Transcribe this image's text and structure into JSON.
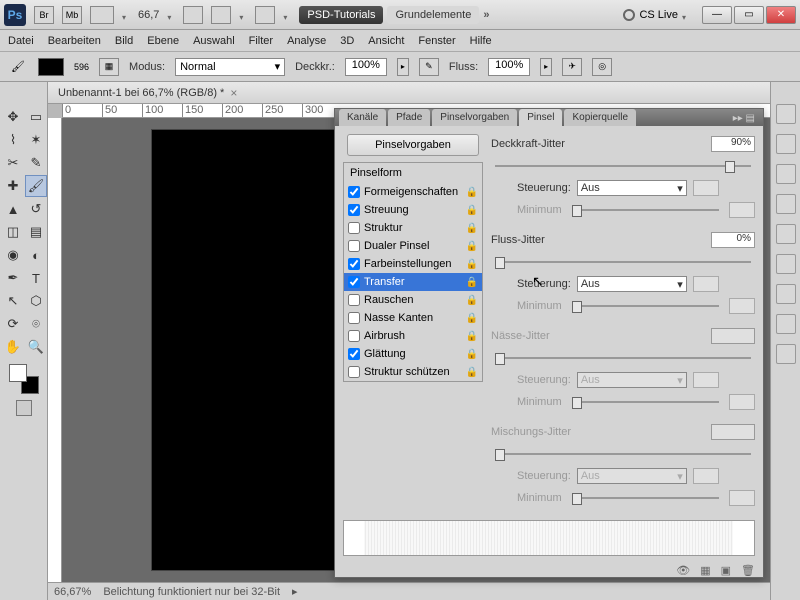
{
  "titlebar": {
    "zoom": "66,7",
    "crumbs": [
      "PSD-Tutorials",
      "Grundelemente"
    ],
    "cslive": "CS Live"
  },
  "menu": [
    "Datei",
    "Bearbeiten",
    "Bild",
    "Ebene",
    "Auswahl",
    "Filter",
    "Analyse",
    "3D",
    "Ansicht",
    "Fenster",
    "Hilfe"
  ],
  "options": {
    "size": "596",
    "mode_label": "Modus:",
    "mode_value": "Normal",
    "opacity_label": "Deckkr.:",
    "opacity_value": "100%",
    "flow_label": "Fluss:",
    "flow_value": "100%"
  },
  "doc": {
    "tab": "Unbenannt-1 bei 66,7% (RGB/8) *",
    "ruler_marks": [
      "0",
      "50",
      "100",
      "150",
      "200",
      "250",
      "300"
    ]
  },
  "status": {
    "zoom": "66,67%",
    "msg": "Belichtung funktioniert nur bei 32-Bit"
  },
  "panel": {
    "tabs": [
      "Kanäle",
      "Pfade",
      "Pinselvorgaben",
      "Pinsel",
      "Kopierquelle"
    ],
    "active_tab": 3,
    "presets_btn": "Pinselvorgaben",
    "shape_header": "Pinselform",
    "items": [
      {
        "label": "Formeigenschaften",
        "checked": true
      },
      {
        "label": "Streuung",
        "checked": true
      },
      {
        "label": "Struktur",
        "checked": false
      },
      {
        "label": "Dualer Pinsel",
        "checked": false
      },
      {
        "label": "Farbeinstellungen",
        "checked": true
      },
      {
        "label": "Transfer",
        "checked": true,
        "selected": true
      },
      {
        "label": "Rauschen",
        "checked": false
      },
      {
        "label": "Nasse Kanten",
        "checked": false
      },
      {
        "label": "Airbrush",
        "checked": false
      },
      {
        "label": "Glättung",
        "checked": true
      },
      {
        "label": "Struktur schützen",
        "checked": false
      }
    ],
    "right": {
      "opacity_jitter": "Deckkraft-Jitter",
      "opacity_jitter_val": "90%",
      "control": "Steuerung:",
      "off": "Aus",
      "minimum": "Minimum",
      "flow_jitter": "Fluss-Jitter",
      "flow_jitter_val": "0%",
      "wet_jitter": "Nässe-Jitter",
      "mix_jitter": "Mischungs-Jitter"
    }
  }
}
